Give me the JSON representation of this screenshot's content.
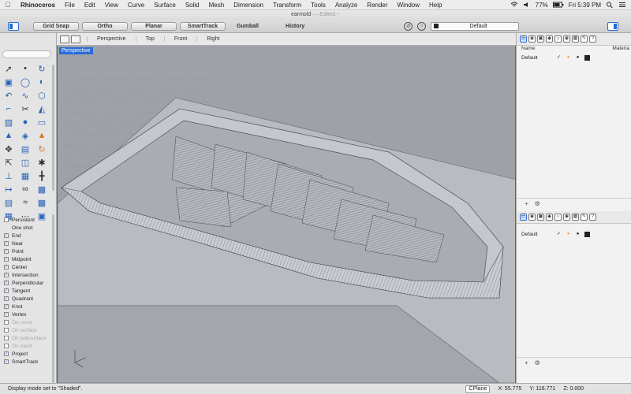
{
  "menubar": {
    "app_name": "Rhinoceros",
    "items": [
      "File",
      "Edit",
      "View",
      "Curve",
      "Surface",
      "Solid",
      "Mesh",
      "Dimension",
      "Transform",
      "Tools",
      "Analyze",
      "Render",
      "Window",
      "Help"
    ],
    "battery": "77%",
    "clock": "Fri 5:39 PM"
  },
  "window": {
    "title": "earmold",
    "edited": "— Edited ~"
  },
  "toolbar": {
    "grid_snap": "Grid Snap",
    "ortho": "Ortho",
    "planar": "Planar",
    "smarttrack": "SmartTrack",
    "gumball": "Gumball",
    "history": "History",
    "layer": "Default"
  },
  "tools": {
    "search_placeholder": "",
    "snaps": [
      {
        "label": "Persistent",
        "checked": false,
        "dim": false
      },
      {
        "label": "One shot",
        "checked": false,
        "dim": false,
        "noind": true
      },
      {
        "label": "End",
        "checked": true,
        "dim": false
      },
      {
        "label": "Near",
        "checked": true,
        "dim": false
      },
      {
        "label": "Point",
        "checked": true,
        "dim": false
      },
      {
        "label": "Midpoint",
        "checked": true,
        "dim": false
      },
      {
        "label": "Center",
        "checked": true,
        "dim": false
      },
      {
        "label": "Intersection",
        "checked": true,
        "dim": false
      },
      {
        "label": "Perpendicular",
        "checked": true,
        "dim": false
      },
      {
        "label": "Tangent",
        "checked": true,
        "dim": false
      },
      {
        "label": "Quadrant",
        "checked": true,
        "dim": false
      },
      {
        "label": "Knot",
        "checked": true,
        "dim": false
      },
      {
        "label": "Vertex",
        "checked": true,
        "dim": false
      },
      {
        "label": "On curve",
        "checked": false,
        "dim": true
      },
      {
        "label": "On surface",
        "checked": false,
        "dim": true
      },
      {
        "label": "On polysurface",
        "checked": false,
        "dim": true
      },
      {
        "label": "On mesh",
        "checked": false,
        "dim": true
      },
      {
        "label": "Project",
        "checked": true,
        "dim": false
      },
      {
        "label": "SmartTrack",
        "checked": true,
        "dim": false
      }
    ]
  },
  "viewport": {
    "tabs": [
      "Perspective",
      "Top",
      "Front",
      "Right"
    ],
    "active_label": "Perspective"
  },
  "layers_panel": {
    "col_name": "Name",
    "col_material": "Materia",
    "layer_name": "Default"
  },
  "layers_panel2": {
    "layer_name": "Default"
  },
  "status": {
    "message": "Display mode set to \"Shaded\".",
    "cplane": "CPlane",
    "x": "X: 55.775",
    "y": "Y: 116.771",
    "z": "Z: 0.000"
  }
}
